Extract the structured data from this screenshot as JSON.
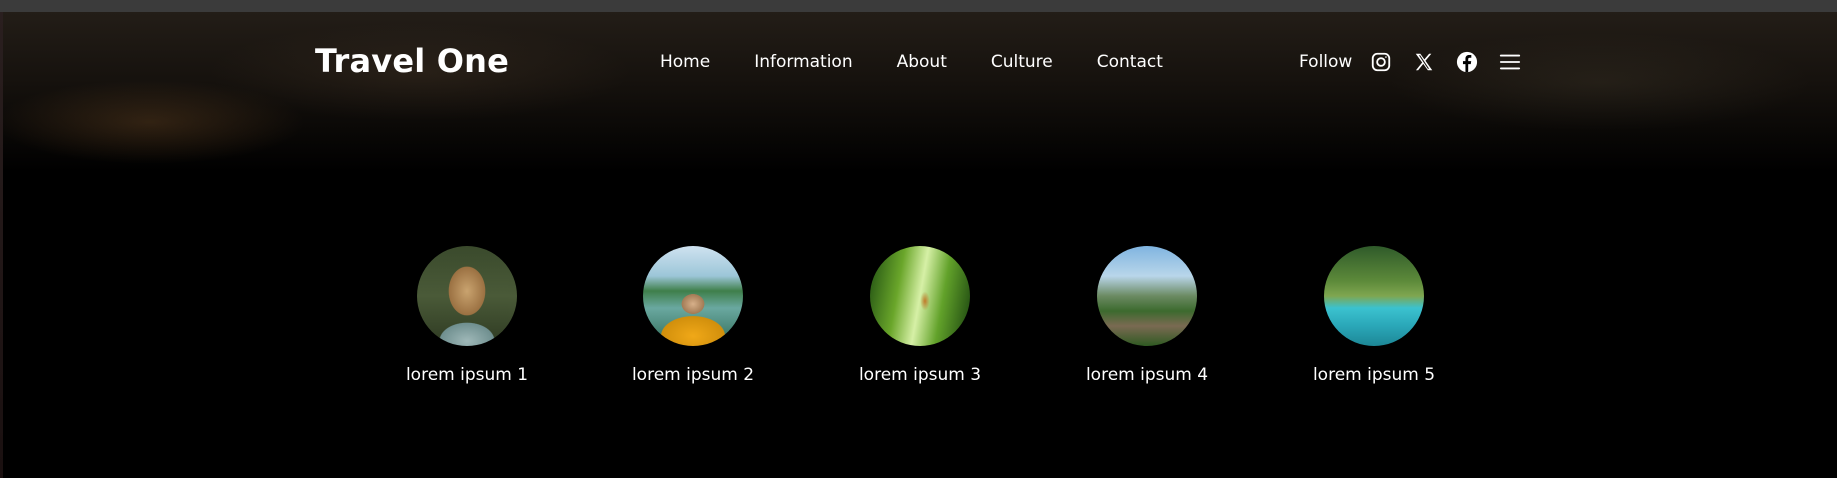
{
  "header": {
    "logo": "Travel One",
    "nav": [
      "Home",
      "Information",
      "About",
      "Culture",
      "Contact"
    ],
    "follow": "Follow",
    "icons": [
      "instagram-icon",
      "x-icon",
      "facebook-icon",
      "menu-icon"
    ]
  },
  "gallery": {
    "items": [
      {
        "caption": "lorem ipsum 1"
      },
      {
        "caption": "lorem ipsum 2"
      },
      {
        "caption": "lorem ipsum 3"
      },
      {
        "caption": "lorem ipsum 4"
      },
      {
        "caption": "lorem ipsum 5"
      }
    ]
  },
  "colors": {
    "background": "#000000",
    "text": "#ffffff",
    "topbar": "#3b3b3b"
  }
}
